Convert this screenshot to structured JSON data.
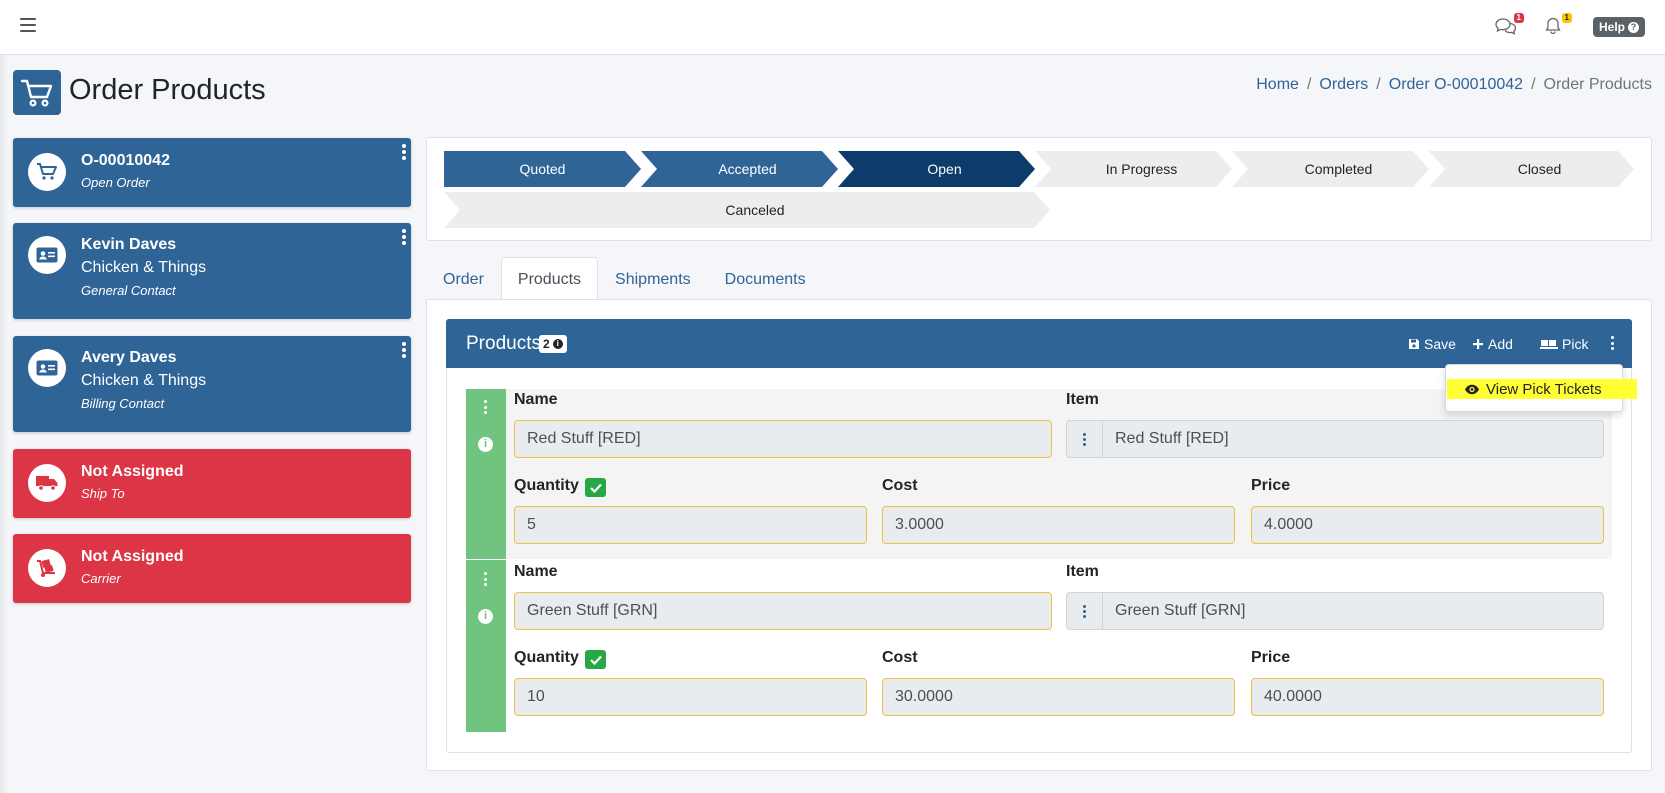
{
  "navbar": {
    "messages_badge": "1",
    "notifications_badge": "1",
    "help_label": "Help",
    "colors": {
      "messages_badge": "#dc3545",
      "notifications_badge": "#ffc107"
    }
  },
  "page": {
    "title": "Order Products",
    "breadcrumb": [
      "Home",
      "Orders",
      "Order O-00010042",
      "Order Products"
    ]
  },
  "cards": [
    {
      "line1": "O-00010042",
      "line2": "",
      "line3": "Open Order",
      "color": "blue",
      "icon": "cart-icon"
    },
    {
      "line1": "Kevin Daves",
      "line2": "Chicken & Things",
      "line3": "General Contact",
      "color": "blue",
      "icon": "id-card-icon"
    },
    {
      "line1": "Avery Daves",
      "line2": "Chicken & Things",
      "line3": "Billing Contact",
      "color": "blue",
      "icon": "id-card-icon"
    },
    {
      "line1": "Not Assigned",
      "line2": "",
      "line3": "Ship To",
      "color": "red",
      "icon": "truck-icon"
    },
    {
      "line1": "Not Assigned",
      "line2": "",
      "line3": "Carrier",
      "color": "red",
      "icon": "dolly-icon"
    }
  ],
  "status_steps": [
    {
      "label": "Quoted",
      "state": "done"
    },
    {
      "label": "Accepted",
      "state": "done"
    },
    {
      "label": "Open",
      "state": "current"
    },
    {
      "label": "In Progress",
      "state": "todo"
    },
    {
      "label": "Completed",
      "state": "todo"
    },
    {
      "label": "Closed",
      "state": "todo"
    },
    {
      "label": "Canceled",
      "state": "todo"
    }
  ],
  "tabs": [
    {
      "label": "Order",
      "active": false
    },
    {
      "label": "Products",
      "active": true
    },
    {
      "label": "Shipments",
      "active": false
    },
    {
      "label": "Documents",
      "active": false
    }
  ],
  "products_panel": {
    "title": "Products",
    "count": "2",
    "save_label": "Save",
    "add_label": "Add",
    "pick_label": "Pick",
    "menu_item": "View Pick Tickets"
  },
  "field_labels": {
    "name": "Name",
    "item": "Item",
    "quantity": "Quantity",
    "cost": "Cost",
    "price": "Price"
  },
  "products": [
    {
      "name": "Red Stuff [RED]",
      "item": "Red Stuff [RED]",
      "quantity": "5",
      "cost": "3.0000",
      "price": "4.0000"
    },
    {
      "name": "Green Stuff [GRN]",
      "item": "Green Stuff [GRN]",
      "quantity": "10",
      "cost": "30.0000",
      "price": "40.0000"
    }
  ],
  "colors": {
    "primary": "#2f6497",
    "current_step": "#0d3c6a",
    "danger": "#dc3545",
    "row_bar": "#70c47f",
    "success": "#28a745",
    "highlight": "#ffff33"
  }
}
